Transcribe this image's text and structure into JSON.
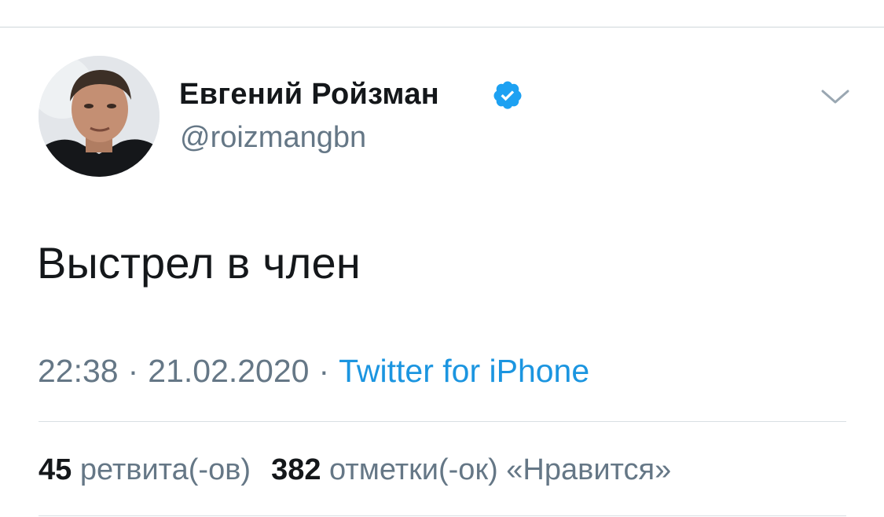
{
  "tweet": {
    "author": {
      "display_name": "Евгений Ройзман",
      "handle": "@roizmangbn",
      "verified": true
    },
    "text": "Выстрел в член",
    "meta": {
      "time": "22:38",
      "separator": "·",
      "date": "21.02.2020",
      "source": "Twitter for iPhone"
    },
    "stats": {
      "retweets_count": "45",
      "retweets_label": "ретвита(-ов)",
      "likes_count": "382",
      "likes_label": "отметки(-ок) «Нравится»"
    }
  },
  "icons": {
    "verified": "verified-badge-icon",
    "menu": "chevron-down-icon"
  },
  "colors": {
    "text_primary": "#14171a",
    "text_secondary": "#657786",
    "link": "#1b95e0",
    "verified_badge": "#1da1f2",
    "divider": "#d9dfe3"
  }
}
